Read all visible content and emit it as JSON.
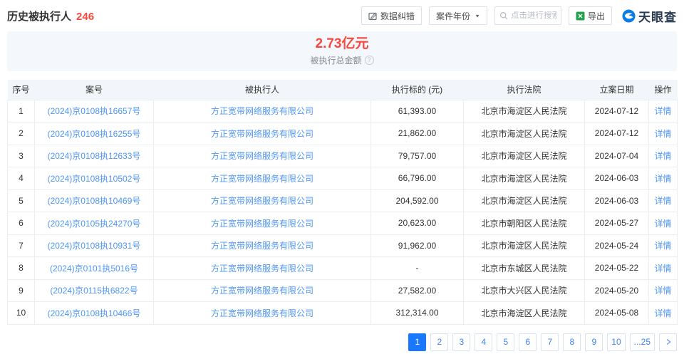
{
  "header": {
    "title": "历史被执行人",
    "count": "246",
    "toolbar": {
      "correction_label": "数据纠错",
      "year_filter_label": "案件年份",
      "search_placeholder": "点击进行搜索",
      "export_label": "导出",
      "logo_text": "天眼查"
    }
  },
  "summary": {
    "amount": "2.73亿元",
    "label": "被执行总金额"
  },
  "table": {
    "columns": [
      "序号",
      "案号",
      "被执行人",
      "执行标的 (元)",
      "执行法院",
      "立案日期",
      "操作"
    ],
    "detail_label": "详情",
    "rows": [
      {
        "no": "1",
        "case_no": "(2024)京0108执16657号",
        "executee": "方正宽带网络服务有限公司",
        "amount": "61,393.00",
        "court": "北京市海淀区人民法院",
        "date": "2024-07-12"
      },
      {
        "no": "2",
        "case_no": "(2024)京0108执16255号",
        "executee": "方正宽带网络服务有限公司",
        "amount": "21,862.00",
        "court": "北京市海淀区人民法院",
        "date": "2024-07-12"
      },
      {
        "no": "3",
        "case_no": "(2024)京0108执12633号",
        "executee": "方正宽带网络服务有限公司",
        "amount": "79,757.00",
        "court": "北京市海淀区人民法院",
        "date": "2024-07-04"
      },
      {
        "no": "4",
        "case_no": "(2024)京0108执10502号",
        "executee": "方正宽带网络服务有限公司",
        "amount": "66,796.00",
        "court": "北京市海淀区人民法院",
        "date": "2024-06-03"
      },
      {
        "no": "5",
        "case_no": "(2024)京0108执10469号",
        "executee": "方正宽带网络服务有限公司",
        "amount": "204,592.00",
        "court": "北京市海淀区人民法院",
        "date": "2024-06-03"
      },
      {
        "no": "6",
        "case_no": "(2024)京0105执24270号",
        "executee": "方正宽带网络服务有限公司",
        "amount": "20,623.00",
        "court": "北京市朝阳区人民法院",
        "date": "2024-05-27"
      },
      {
        "no": "7",
        "case_no": "(2024)京0108执10931号",
        "executee": "方正宽带网络服务有限公司",
        "amount": "91,962.00",
        "court": "北京市海淀区人民法院",
        "date": "2024-05-24"
      },
      {
        "no": "8",
        "case_no": "(2024)京0101执5016号",
        "executee": "方正宽带网络服务有限公司",
        "amount": "-",
        "court": "北京市东城区人民法院",
        "date": "2024-05-22"
      },
      {
        "no": "9",
        "case_no": "(2024)京0115执6822号",
        "executee": "方正宽带网络服务有限公司",
        "amount": "27,582.00",
        "court": "北京市大兴区人民法院",
        "date": "2024-05-20"
      },
      {
        "no": "10",
        "case_no": "(2024)京0108执10466号",
        "executee": "方正宽带网络服务有限公司",
        "amount": "312,314.00",
        "court": "北京市海淀区人民法院",
        "date": "2024-05-08"
      }
    ]
  },
  "pagination": {
    "pages": [
      "1",
      "2",
      "3",
      "4",
      "5",
      "6",
      "7",
      "8",
      "9",
      "10",
      "...25"
    ],
    "active": "1"
  },
  "colors": {
    "accent_red": "#f8473c",
    "link_blue": "#4e96f7",
    "page_active_blue": "#1a78ff",
    "export_green": "#23a24d",
    "logo_blue": "#0a7ce8"
  }
}
